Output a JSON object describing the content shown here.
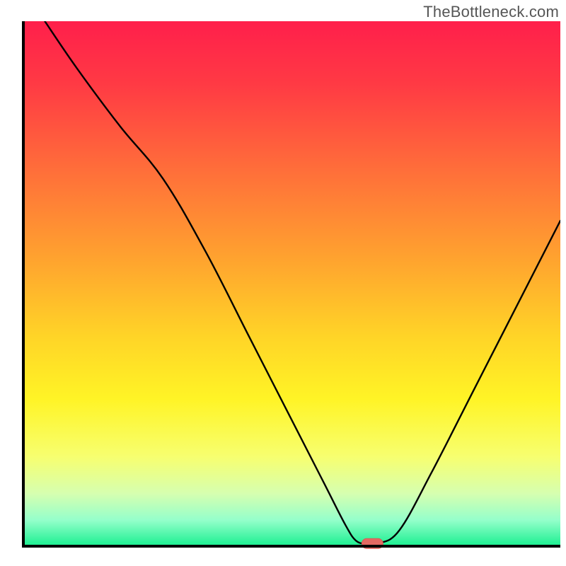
{
  "watermark": "TheBottleneck.com",
  "colors": {
    "axis": "#000000",
    "curve": "#000000",
    "marker_fill": "#e46a63",
    "marker_stroke": "#d95a54",
    "gradient_stops": [
      {
        "offset": 0.0,
        "color": "#ff1f4b"
      },
      {
        "offset": 0.12,
        "color": "#ff3a44"
      },
      {
        "offset": 0.28,
        "color": "#ff6d3a"
      },
      {
        "offset": 0.45,
        "color": "#ffa22f"
      },
      {
        "offset": 0.6,
        "color": "#ffd427"
      },
      {
        "offset": 0.72,
        "color": "#fff426"
      },
      {
        "offset": 0.83,
        "color": "#f7ff70"
      },
      {
        "offset": 0.9,
        "color": "#d6ffb0"
      },
      {
        "offset": 0.95,
        "color": "#95ffcb"
      },
      {
        "offset": 1.0,
        "color": "#19ef90"
      }
    ]
  },
  "chart_data": {
    "type": "line",
    "title": "",
    "xlabel": "",
    "ylabel": "",
    "xlim": [
      0,
      100
    ],
    "ylim": [
      0,
      100
    ],
    "x": [
      4,
      10,
      18,
      26,
      34,
      42,
      50,
      56,
      60,
      62,
      64,
      66,
      70,
      76,
      84,
      92,
      100
    ],
    "values": [
      100,
      91,
      80,
      70,
      56,
      40,
      24,
      12,
      4,
      1,
      0.5,
      0.5,
      3,
      14,
      30,
      46,
      62
    ],
    "marker": {
      "x": 65,
      "y": 0.5,
      "shape": "pill"
    }
  }
}
